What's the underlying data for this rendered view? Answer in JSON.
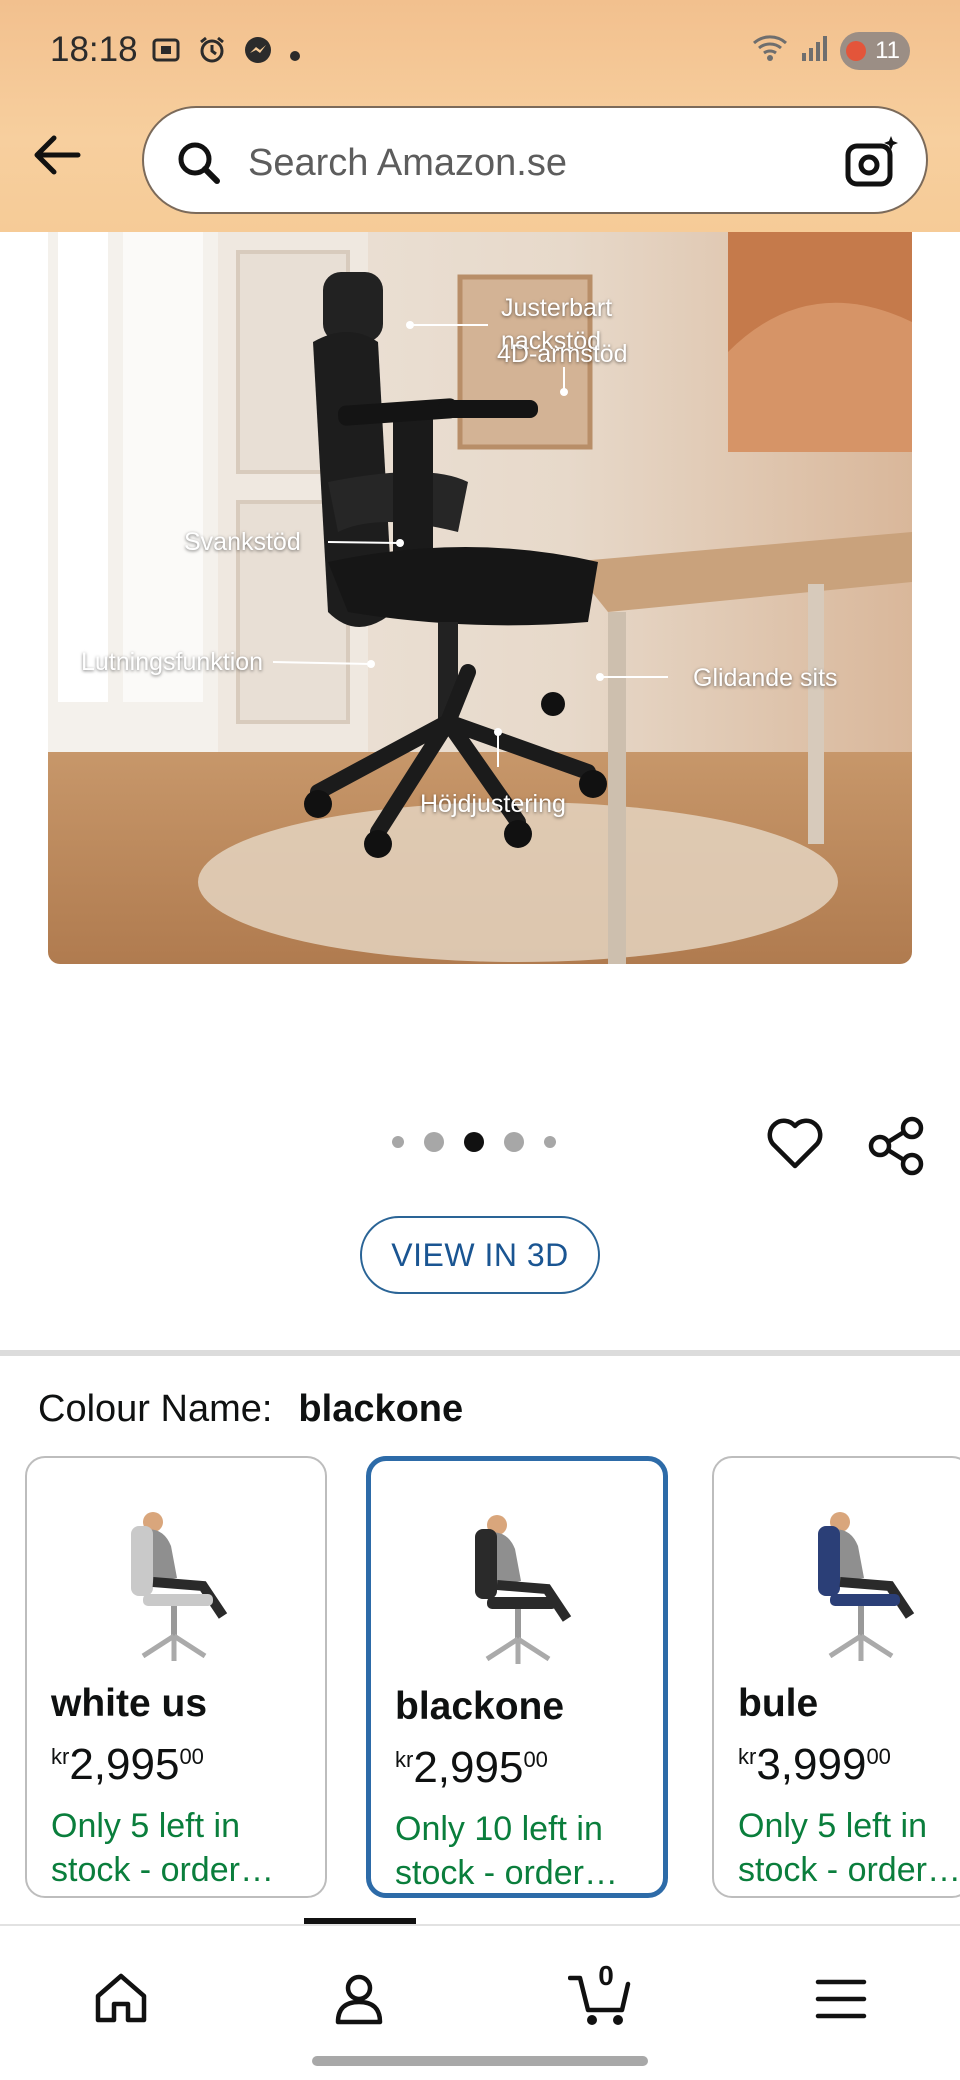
{
  "status_bar": {
    "time": "18:18",
    "battery": "11",
    "left_icons": [
      "screenshot-icon",
      "alarm-icon",
      "messenger-icon",
      "dot-icon"
    ],
    "right_icons": [
      "wifi-icon",
      "signal-icon",
      "battery-icon"
    ]
  },
  "search": {
    "placeholder": "Search Amazon.se"
  },
  "product_image": {
    "labels": {
      "headrest": "Justerbart\nnackstöd",
      "armrest": "4D-armstöd",
      "lumbar": "Svankstöd",
      "tilt": "Lutningsfunktion",
      "sliding_seat": "Glidande sits",
      "height": "Höjdjustering"
    }
  },
  "carousel": {
    "total": 5,
    "active_index": 2
  },
  "view_3d": {
    "label": "VIEW IN 3D"
  },
  "colour": {
    "label": "Colour Name:",
    "value": "blackone"
  },
  "variants": [
    {
      "name": "white us",
      "currency": "kr",
      "price_whole": "2,995",
      "price_fraction": "00",
      "stock": "Only 5 left in\nstock - order…",
      "selected": false,
      "color": "#c9c9c9"
    },
    {
      "name": "blackone",
      "currency": "kr",
      "price_whole": "2,995",
      "price_fraction": "00",
      "stock": "Only 10 left in\nstock - order…",
      "selected": true,
      "color": "#2a2a2a"
    },
    {
      "name": "bule",
      "currency": "kr",
      "price_whole": "3,999",
      "price_fraction": "00",
      "stock": "Only 5 left in\nstock - order…",
      "selected": false,
      "color": "#2b3f77"
    }
  ],
  "bottom_nav": {
    "cart_count": "0",
    "items": [
      "home-icon",
      "account-icon",
      "cart-icon",
      "menu-icon"
    ]
  },
  "colors": {
    "header": "#f7cf9e",
    "accent_blue": "#2d6ba8",
    "stock_green": "#0a7e3c"
  }
}
